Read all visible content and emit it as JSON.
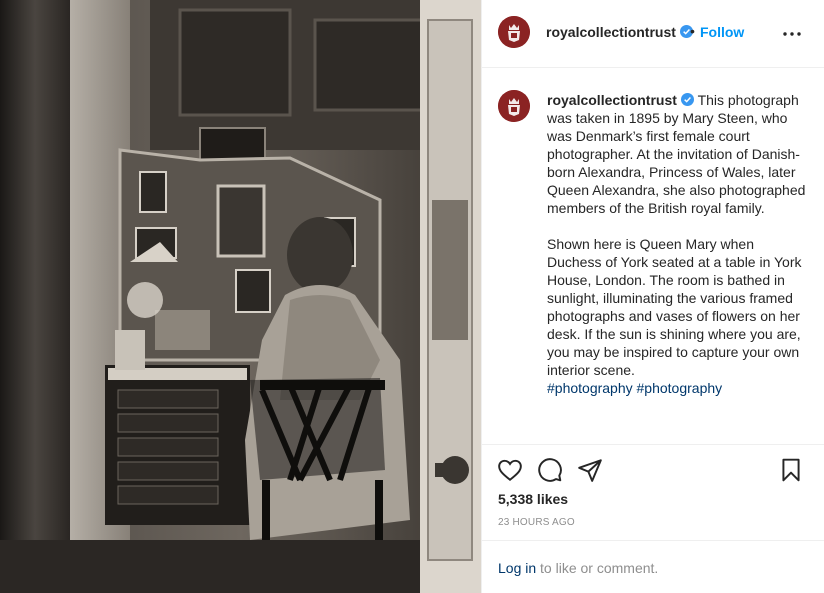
{
  "post": {
    "image_alt": "Black and white photograph of a woman seated at a desk in a room",
    "account": "royalcollectiontrust",
    "follow_label": "Follow",
    "separator": "•",
    "caption_para1": "This photograph was taken in 1895 by Mary Steen, who was Denmark’s first female court photographer. At the invitation of Danish-born Alexandra, Princess of Wales, later Queen Alexandra, she also photographed members of the British royal family.",
    "caption_para2": "Shown here is Queen Mary when Duchess of York seated at a table in York House, London. The room is bathed in sunlight, illuminating the various framed photographs and vases of flowers on her desk. If the sun is shining where you are, you may be inspired to capture your own interior scene.",
    "hashtags": "#photography #photography",
    "likes": "5,338 likes",
    "time": "23 HOURS AGO",
    "login_link": "Log in",
    "login_suffix": " to like or comment."
  },
  "icons": {
    "verified": "verified-badge-icon",
    "more": "more-options-icon",
    "like": "heart-icon",
    "comment": "comment-icon",
    "share": "share-icon",
    "save": "bookmark-icon"
  },
  "colors": {
    "brand_avatar": "#8b2323",
    "follow": "#0095f6",
    "verified": "#3897f0",
    "link": "#00376b",
    "muted": "#8e8e8e"
  }
}
